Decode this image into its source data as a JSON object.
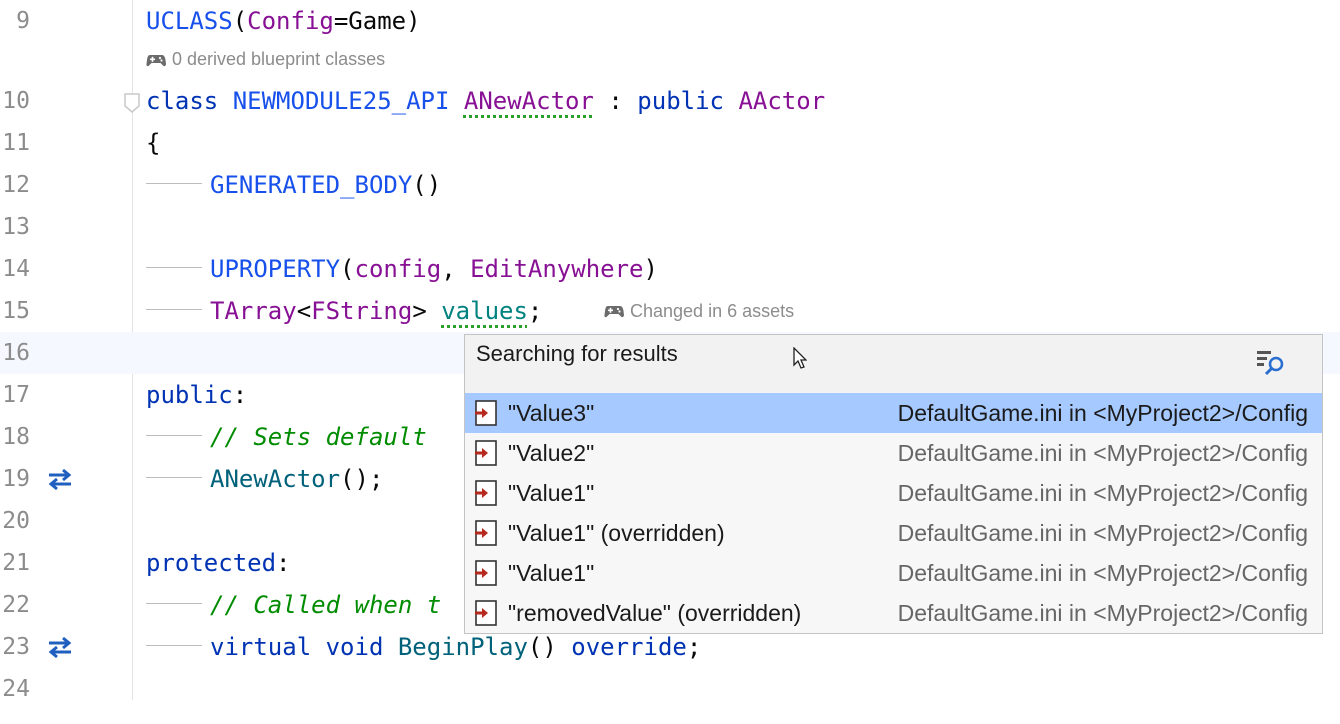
{
  "editor": {
    "lines": [
      {
        "n": "9"
      },
      {
        "n": "10"
      },
      {
        "n": "11"
      },
      {
        "n": "12"
      },
      {
        "n": "13"
      },
      {
        "n": "14"
      },
      {
        "n": "15"
      },
      {
        "n": "16"
      },
      {
        "n": "17"
      },
      {
        "n": "18"
      },
      {
        "n": "19"
      },
      {
        "n": "20"
      },
      {
        "n": "21"
      },
      {
        "n": "22"
      },
      {
        "n": "23"
      },
      {
        "n": "24"
      }
    ],
    "code": {
      "l9": {
        "a": "UCLASS",
        "b": "(",
        "c": "Config",
        "d": "=Game)"
      },
      "l10": {
        "a": "class ",
        "b": "NEWMODULE25_API ",
        "c": "ANewActor",
        "d": " : ",
        "e": "public ",
        "f": "AActor"
      },
      "l11": {
        "a": "{"
      },
      "l12": {
        "a": "GENERATED_BODY",
        "b": "()"
      },
      "l14": {
        "a": "UPROPERTY",
        "b": "(",
        "c": "config",
        "d": ", ",
        "e": "EditAnywhere",
        "f": ")"
      },
      "l15": {
        "a": "TArray",
        "b": "<",
        "c": "FString",
        "d": "> ",
        "e": "values",
        "f": ";"
      },
      "l17": {
        "a": "public",
        "b": ":"
      },
      "l18": {
        "a": "// Sets default "
      },
      "l19": {
        "a": "ANewActor",
        "b": "();"
      },
      "l21": {
        "a": "protected",
        "b": ":"
      },
      "l22": {
        "a": "// Called when t"
      },
      "l23": {
        "a": "virtual ",
        "b": "void ",
        "c": "BeginPlay",
        "d": "() ",
        "e": "override",
        "f": ";"
      }
    },
    "hints": {
      "derived": "0 derived blueprint classes",
      "changed": "Changed in 6 assets"
    },
    "icons": {
      "gamepad": "gamepad-icon",
      "override_marker": "override-arrows-icon",
      "fold": "fold-marker-icon"
    }
  },
  "popup": {
    "title": "Searching for results",
    "filter_icon": "filter-search-icon",
    "results": [
      {
        "label": "\"Value3\"",
        "location": "DefaultGame.ini in <MyProject2>/Config",
        "selected": true
      },
      {
        "label": "\"Value2\"",
        "location": "DefaultGame.ini in <MyProject2>/Config"
      },
      {
        "label": "\"Value1\"",
        "location": "DefaultGame.ini in <MyProject2>/Config"
      },
      {
        "label": "\"Value1\" (overridden)",
        "location": "DefaultGame.ini in <MyProject2>/Config"
      },
      {
        "label": "\"Value1\"",
        "location": "DefaultGame.ini in <MyProject2>/Config"
      },
      {
        "label": "\"removedValue\" (overridden)",
        "location": "DefaultGame.ini in <MyProject2>/Config"
      }
    ]
  },
  "colors": {
    "keyword": "#0033b3",
    "macro": "#1750eb",
    "type": "#871094",
    "field": "#00827f",
    "comment": "#008c00",
    "selection": "#a6c9ff",
    "ini_icon": "#b52a1c"
  }
}
